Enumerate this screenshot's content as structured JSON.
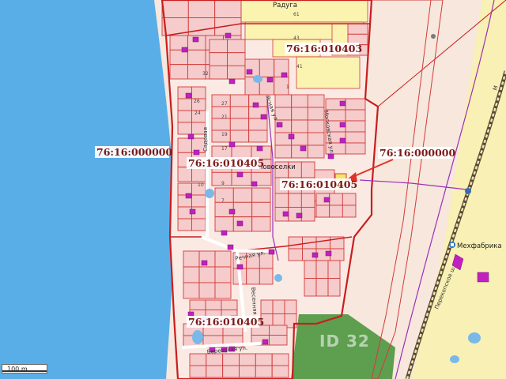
{
  "map": {
    "colors": {
      "water": "#5aaee8",
      "zone_fill": "#f6e4dc",
      "parcel_fill": "#f5cbcb",
      "parcel_border": "#d23b3b",
      "zone_border": "#c81e1e",
      "yellow_parcel": "#fbf3b0",
      "green_field": "#5e9e4f",
      "railway": "#5a4a3a",
      "arrow": "#e23226",
      "purple_line": "#9b30b8",
      "building": "#c21fc2"
    },
    "cadastral_labels": [
      {
        "id": "north",
        "text": "76:16:010403"
      },
      {
        "id": "west",
        "text": "76:16:000000"
      },
      {
        "id": "east",
        "text": "76:16:000000"
      },
      {
        "id": "center-left",
        "text": "76:16:010405"
      },
      {
        "id": "center",
        "text": "76:16:010405"
      },
      {
        "id": "south",
        "text": "76:16:010405"
      }
    ],
    "places": {
      "settlement": "Новоселки",
      "poi": "Мехфабрика",
      "top": "Радуга"
    },
    "streets": {
      "sadovaya": "Садовая",
      "rechnaya": "Речная ул.",
      "moskovskaya": "Московская ул.",
      "yasnaya": "Ясная ул.",
      "vesennyaya": "Весенняя ул.",
      "berezovaya": "Березовая ул.",
      "highway": "Перекопское ш.",
      "top_right": "М"
    },
    "plot_numbers": [
      "32",
      "27",
      "26",
      "24",
      "21",
      "19",
      "17",
      "10",
      "9",
      "7",
      "61",
      "43",
      "41",
      "1"
    ],
    "scale_label": "100 m",
    "watermark": "ID 32"
  }
}
